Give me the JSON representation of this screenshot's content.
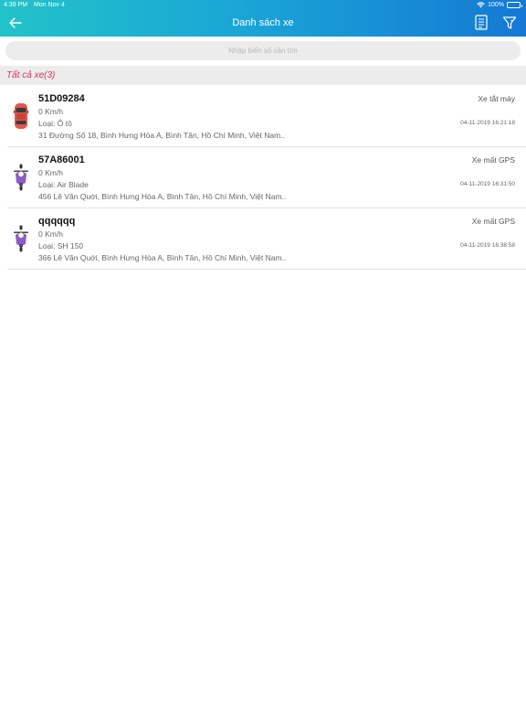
{
  "status_bar": {
    "time": "4:39 PM",
    "date": "Mon Nov 4",
    "battery": "100%"
  },
  "header": {
    "title": "Danh sách xe",
    "icons": {
      "back": "arrow-left-icon",
      "list": "document-list-icon",
      "filter": "filter-icon"
    }
  },
  "search": {
    "placeholder": "Nhập biển số cần tìm"
  },
  "section": {
    "label": "Tất cả xe(3)"
  },
  "vehicles": [
    {
      "plate": "51D09284",
      "speed": "0 Km/h",
      "type": "Loại: Ô tô",
      "address": "31 Đường Số 18, Bình Hưng Hòa A, Bình Tân, Hồ Chí Minh, Việt Nam..",
      "status": "Xe tắt máy",
      "time": "04-11-2019 16:21:18",
      "icon": "car-icon"
    },
    {
      "plate": "57A86001",
      "speed": "0 Km/h",
      "type": "Loại: Air Blade",
      "address": "456 Lê Văn Quới, Bình Hưng Hòa A, Bình Tân, Hồ Chí Minh, Việt Nam..",
      "status": "Xe mất GPS",
      "time": "04-11-2019 16:31:50",
      "icon": "motorbike-icon"
    },
    {
      "plate": "qqqqqq",
      "speed": "0 Km/h",
      "type": "Loại: SH 150",
      "address": "366 Lê Văn Quới, Bình Hưng Hòa A, Bình Tân, Hồ Chí Minh, Việt Nam..",
      "status": "Xe mất GPS",
      "time": "04-11-2019 16:38:58",
      "icon": "motorbike-icon"
    }
  ],
  "colors": {
    "header_start": "#22c3c9",
    "header_end": "#1479d4",
    "section_text": "#e0315c",
    "car": "#e2574c",
    "rider": "#8e5bc8"
  }
}
